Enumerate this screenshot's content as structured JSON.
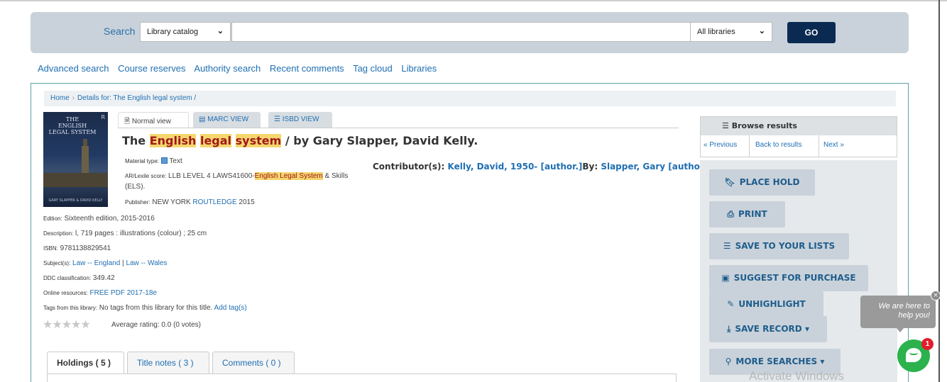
{
  "search": {
    "label": "Search",
    "catalog_select": "Library catalog",
    "query_value": "",
    "libraries_select": "All libraries",
    "go_label": "GO"
  },
  "toplinks": [
    "Advanced search",
    "Course reserves",
    "Authority search",
    "Recent comments",
    "Tag cloud",
    "Libraries"
  ],
  "breadcrumb": {
    "home": "Home",
    "sep": "›",
    "current": "Details for: The English legal system /"
  },
  "cover": {
    "title_line1": "THE",
    "title_line2": "ENGLISH",
    "title_line3": "LEGAL SYSTEM",
    "publisher_mark": "R",
    "authors": "GARY SLAPPER & DAVID KELLY"
  },
  "views": {
    "normal": "Normal view",
    "marc": "MARC VIEW",
    "isbd": "ISBD VIEW"
  },
  "record": {
    "title_prefix": "The ",
    "title_hl1": "English",
    "title_hl2": "legal",
    "title_hl3": "system",
    "title_suffix": " / by Gary Slapper, David Kelly.",
    "material_type_label": "Material type:",
    "material_type_value": "Text",
    "arlexile_label": "AR/Lexile score:",
    "arlexile_prefix": " LLB LEVEL 4 LAWS41600-",
    "arlexile_hl": "English Legal System",
    "arlexile_suffix": " & Skills",
    "arlexile_line2": "(ELS).",
    "publisher_label": "Publisher:",
    "publisher_place": " NEW YORK ",
    "publisher_name": "ROUTLEDGE",
    "publisher_year": " 2015",
    "edition_label": "Edition:",
    "edition_value": " Sixteenth edition, 2015-2016",
    "description_label": "Description:",
    "description_value": " l, 719 pages : illustrations (colour) ; 25 cm",
    "isbn_label": "ISBN:",
    "isbn_value": " 9781138829541",
    "subjects_label": "Subject(s):",
    "subject1": "Law -- England",
    "subject_sep": " | ",
    "subject2": "Law -- Wales",
    "ddc_label": "DDC classification:",
    "ddc_value": " 349.42",
    "online_label": "Online resources:",
    "online_value": "FREE PDF 2017-18e",
    "tags_label": "Tags from this library:",
    "tags_value": " No tags from this library for this title.",
    "add_tag": "Add tag(s)",
    "rating_text": "Average rating: 0.0 (0 votes)",
    "rating_value": 0,
    "rating_max": 5
  },
  "contributors": {
    "label": "Contributor(s):",
    "author1": "Kelly, David, 1950- [author.]",
    "by_label": "By:",
    "author2": "Slapper, Gary [author.]"
  },
  "browse": {
    "title": "Browse results",
    "previous": "« Previous",
    "back": "Back to results",
    "next": "Next »"
  },
  "actions": {
    "place_hold": "PLACE HOLD",
    "print": "PRINT",
    "save_lists": "SAVE TO YOUR LISTS",
    "suggest": "SUGGEST FOR PURCHASE",
    "unhighlight": "UNHIGHLIGHT",
    "save_record": "SAVE RECORD",
    "more_searches": "MORE SEARCHES"
  },
  "holdings_tabs": {
    "holdings": "Holdings ( 5 )",
    "notes": "Title notes ( 3 )",
    "comments": "Comments ( 0 )"
  },
  "chat": {
    "bubble_line1": "We are here to",
    "bubble_line2": "help you!",
    "badge": "1",
    "close": "×"
  },
  "watermark": "Activate Windows",
  "colors": {
    "link": "#1f6fb2",
    "highlight_bg": "#f5d76e",
    "highlight_fg": "#a0191b",
    "go_button": "#0b2a52",
    "chat_green": "#2bb24c",
    "badge_red": "#e11d2c"
  }
}
